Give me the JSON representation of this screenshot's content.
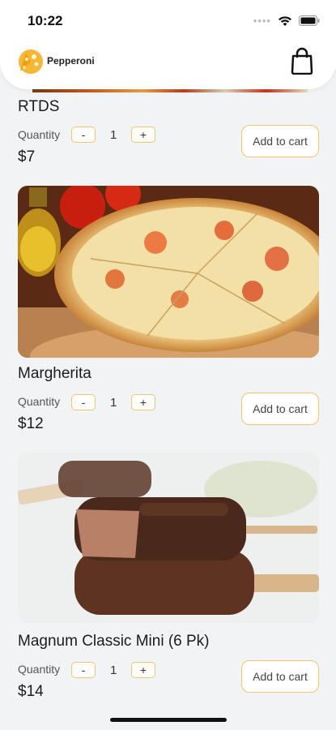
{
  "status_bar": {
    "time": "10:22"
  },
  "header": {
    "brand": "Pepperoni"
  },
  "products": [
    {
      "name": "RTDS",
      "quantity_label": "Quantity",
      "minus": "-",
      "plus": "+",
      "quantity": "1",
      "price": "$7",
      "add_label": "Add to cart"
    },
    {
      "name": "Margherita",
      "quantity_label": "Quantity",
      "minus": "-",
      "plus": "+",
      "quantity": "1",
      "price": "$12",
      "add_label": "Add to cart"
    },
    {
      "name": "Magnum Classic Mini (6 Pk)",
      "quantity_label": "Quantity",
      "minus": "-",
      "plus": "+",
      "quantity": "1",
      "price": "$14",
      "add_label": "Add to cart"
    }
  ],
  "colors": {
    "accent": "#f6c46a",
    "background": "#f2f3f5"
  }
}
